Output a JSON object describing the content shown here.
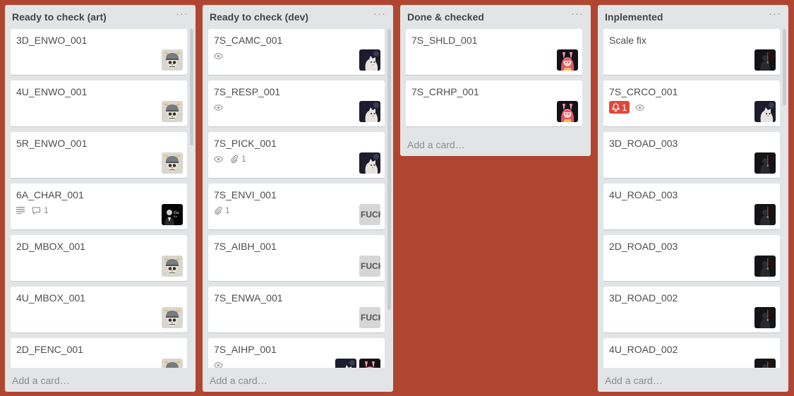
{
  "lists": [
    {
      "title": "Ready to check (art)",
      "menu": "···",
      "add_card": "Add a card…",
      "cards": [
        {
          "title": "3D_ENWO_001",
          "members": [
            "skull-helmet-avatar"
          ]
        },
        {
          "title": "4U_ENWO_001",
          "members": [
            "skull-helmet-avatar"
          ]
        },
        {
          "title": "5R_ENWO_001",
          "members": [
            "skull-helmet-avatar"
          ]
        },
        {
          "title": "6A_CHAR_001",
          "badges": {
            "description": true,
            "comments": "1"
          },
          "members": [
            "godfather-avatar"
          ]
        },
        {
          "title": "2D_MBOX_001",
          "members": [
            "skull-helmet-avatar"
          ]
        },
        {
          "title": "4U_MBOX_001",
          "members": [
            "skull-helmet-avatar"
          ]
        },
        {
          "title": "2D_FENC_001",
          "members": [
            "skull-helmet-avatar"
          ]
        }
      ]
    },
    {
      "title": "Ready to check (dev)",
      "menu": "···",
      "add_card": "Add a card…",
      "cards": [
        {
          "title": "7S_CAMC_001",
          "badges": {
            "watch": true
          },
          "members": [
            "cat-avatar"
          ]
        },
        {
          "title": "7S_RESP_001",
          "badges": {
            "watch": true
          },
          "members": [
            "cat-avatar"
          ]
        },
        {
          "title": "7S_PICK_001",
          "badges": {
            "watch": true,
            "attachments": "1"
          },
          "members": [
            "cat-avatar"
          ]
        },
        {
          "title": "7S_ENVI_001",
          "badges": {
            "attachments": "1"
          },
          "members": [
            "text-avatar"
          ]
        },
        {
          "title": "7S_AIBH_001",
          "members": [
            "text-avatar"
          ]
        },
        {
          "title": "7S_ENWA_001",
          "members": [
            "text-avatar"
          ]
        },
        {
          "title": "7S_AIHP_001",
          "badges": {
            "watch": true
          },
          "members": [
            "cat-avatar",
            "anime-girl-avatar"
          ]
        }
      ],
      "text_avatar_label": "FUCK"
    },
    {
      "title": "Done & checked",
      "menu": "···",
      "add_card": "Add a card…",
      "cards": [
        {
          "title": "7S_SHLD_001",
          "members": [
            "anime-girl-avatar"
          ]
        },
        {
          "title": "7S_CRHP_001",
          "members": [
            "anime-girl-avatar"
          ]
        }
      ]
    },
    {
      "title": "Inplemented",
      "menu": "···",
      "add_card": "Add a card…",
      "cards": [
        {
          "title": "Scale fix",
          "members": [
            "dark-figure-avatar"
          ]
        },
        {
          "title": "7S_CRCO_001",
          "badges": {
            "alert": "1",
            "watch": true
          },
          "members": [
            "cat-avatar"
          ]
        },
        {
          "title": "3D_ROAD_003",
          "members": [
            "dark-figure-avatar"
          ]
        },
        {
          "title": "4U_ROAD_003",
          "members": [
            "dark-figure-avatar"
          ]
        },
        {
          "title": "2D_ROAD_003",
          "members": [
            "dark-figure-avatar"
          ]
        },
        {
          "title": "3D_ROAD_002",
          "members": [
            "dark-figure-avatar"
          ]
        },
        {
          "title": "4U_ROAD_002",
          "members": [
            "dark-figure-avatar"
          ]
        }
      ]
    }
  ],
  "colors": {
    "board_background": "#b04632",
    "list_background": "#e2e4e6",
    "alert_badge": "#e0483a"
  }
}
